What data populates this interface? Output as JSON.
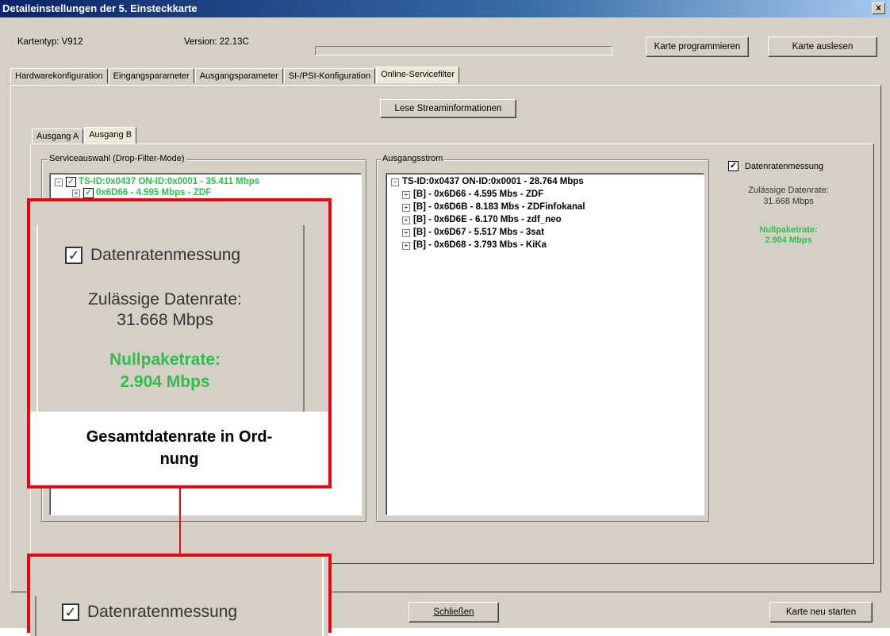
{
  "window": {
    "title": "Detaileinstellungen der 5. Einsteckkarte",
    "close": "x"
  },
  "header": {
    "kartentyp": "Kartentyp:  V912",
    "version": "Version:  22.13C",
    "btn_program": "Karte programmieren",
    "btn_read": "Karte auslesen"
  },
  "tabs": [
    "Hardwarekonfiguration",
    "Eingangsparameter",
    "Ausgangsparameter",
    "SI-/PSI-Konfiguration",
    "Online-Servicefilter"
  ],
  "stream_button": "Lese Streaminformationen",
  "subtabs": [
    "Ausgang A",
    "Ausgang B"
  ],
  "service_group": {
    "legend": "Serviceauswahl (Drop-Filter-Mode)",
    "items": [
      {
        "label": "TS-ID:0x0437   ON-ID:0x0001 - 35.411 Mbps"
      },
      {
        "label": "0x6D66 - 4.595 Mbps - ZDF"
      }
    ]
  },
  "output_group": {
    "legend": "Ausgangsstrom",
    "root": "TS-ID:0x0437   ON-ID:0x0001 - 28.764 Mbps",
    "items": [
      "[B] - 0x6D66 - 4.595 Mbs - ZDF",
      "[B] - 0x6D6B - 8.183 Mbs - ZDFinfokanal",
      "[B] - 0x6D6E - 6.170 Mbs - zdf_neo",
      "[B] - 0x6D67 - 5.517 Mbs - 3sat",
      "[B] - 0x6D68 - 3.793 Mbs - KiKa"
    ]
  },
  "rate_panel": {
    "checkbox_label": "Datenratenmessung",
    "allowed_label": "Zulässige Datenrate:",
    "allowed_value": "31.668 Mbps",
    "null_label": "Nullpaketrate:",
    "null_value": "2.904 Mbps"
  },
  "footer": {
    "close_button": "Schließen",
    "restart_button": "Karte neu starten"
  },
  "callout": {
    "checkbox_label": "Datenratenmessung",
    "allowed_label": "Zulässige Datenrate:",
    "allowed_value": "31.668 Mbps",
    "null_label": "Nullpaketrate:",
    "null_value": "2.904 Mbps",
    "caption_line1": "Gesamtdatenrate in Ord-",
    "caption_line2": "nung",
    "lower_checkbox_label": "Datenratenmessung"
  },
  "colors": {
    "highlight": "#e30613",
    "ok_green": "#2ec04a",
    "titlebar": "#0a246a"
  }
}
